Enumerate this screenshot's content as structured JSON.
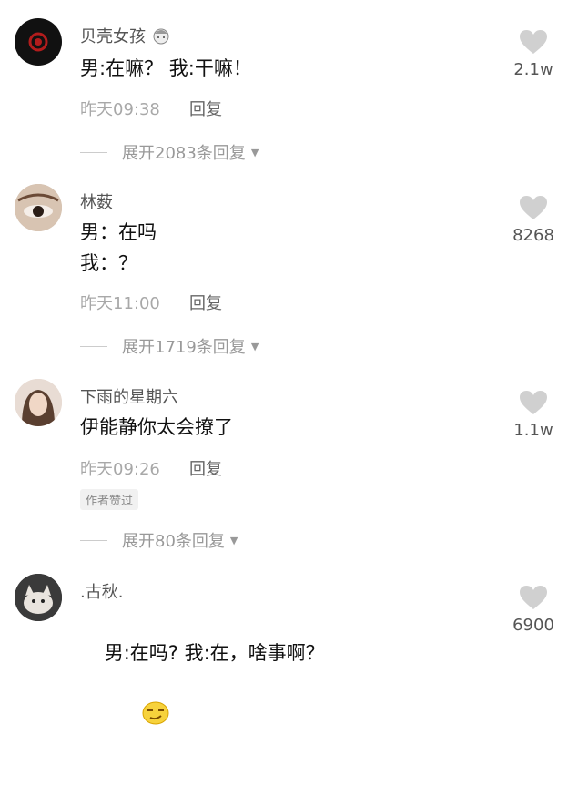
{
  "comments": [
    {
      "username": "贝壳女孩",
      "text": "男:在嘛？ 我:干嘛！",
      "time": "昨天09:38",
      "reply_label": "回复",
      "expand_label": "展开2083条回复",
      "likes": "2.1w",
      "avatar": "dark-red-logo-avatar"
    },
    {
      "username": "林薮",
      "text": "男：在吗\n我：？",
      "time": "昨天11:00",
      "reply_label": "回复",
      "expand_label": "展开1719条回复",
      "likes": "8268",
      "avatar": "eye-closeup-avatar"
    },
    {
      "username": "下雨的星期六",
      "text": "伊能静你太会撩了",
      "time": "昨天09:26",
      "reply_label": "回复",
      "author_badge": "作者赞过",
      "expand_label": "展开80条回复",
      "likes": "1.1w",
      "avatar": "woman-portrait-avatar"
    },
    {
      "username": ".古秋.",
      "text": "男:在吗? 我:在，啥事啊？",
      "likes": "6900",
      "avatar": "cat-avatar"
    }
  ],
  "colors": {
    "like": "#d0d0d0",
    "meta": "#a8a8a8"
  }
}
